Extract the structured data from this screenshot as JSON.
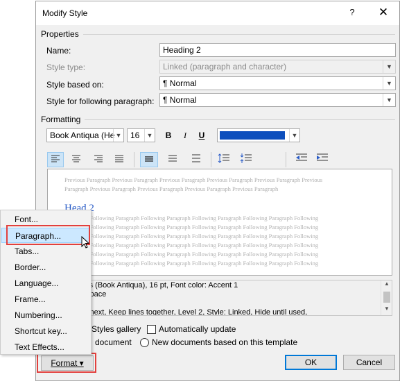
{
  "dialog": {
    "title": "Modify Style",
    "help": "?",
    "close": "✕"
  },
  "properties": {
    "heading": "Properties",
    "name_label": "Name:",
    "name_value": "Heading 2",
    "style_type_label": "Style type:",
    "style_type_value": "Linked (paragraph and character)",
    "based_on_label": "Style based on:",
    "based_on_value": "¶  Normal",
    "following_label": "Style for following paragraph:",
    "following_value": "¶  Normal"
  },
  "formatting": {
    "heading": "Formatting",
    "font_name": "Book Antiqua (He",
    "font_size": "16",
    "bold": "B",
    "italic": "I",
    "underline": "U",
    "font_color": "#0d4fbd"
  },
  "preview": {
    "previous_line1": "Previous Paragraph Previous Paragraph Previous Paragraph Previous Paragraph Previous Paragraph Previous",
    "previous_line2": "Paragraph Previous Paragraph Previous Paragraph Previous Paragraph Previous Paragraph",
    "sample": "Head 2",
    "following_line": "Paragraph Following Paragraph Following Paragraph Following Paragraph Following Paragraph Following"
  },
  "description": {
    "line1": "lt) +Headings (Book Antiqua), 16 pt, Font color: Accent 1",
    "line2": "ng:  single, Space",
    "line3": "pt",
    "line4": "t, Keep with next, Keep lines together, Level 2, Style: Linked, Hide until used,"
  },
  "options": {
    "gallery_label": "Styles gallery",
    "auto_update_label": "Automatically update",
    "doc_label": "document",
    "template_label": "New documents based on this template"
  },
  "buttons": {
    "format": "Format ▾",
    "ok": "OK",
    "cancel": "Cancel"
  },
  "format_menu": {
    "items": [
      "Font...",
      "Paragraph...",
      "Tabs...",
      "Border...",
      "Language...",
      "Frame...",
      "Numbering...",
      "Shortcut key...",
      "Text Effects..."
    ]
  }
}
